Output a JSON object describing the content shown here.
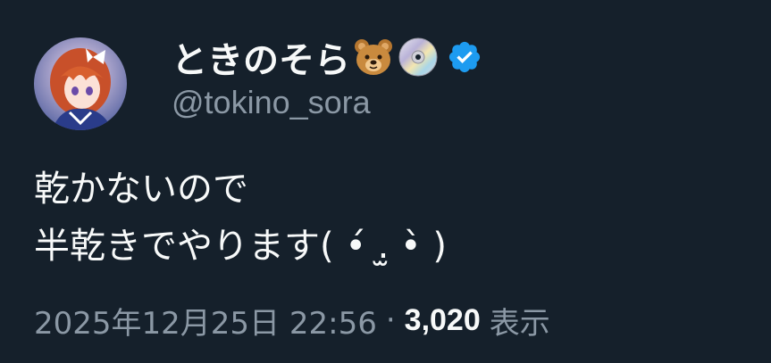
{
  "author": {
    "display_name": "ときのそら",
    "name_emojis": [
      "bear-face-emoji",
      "dvd-emoji"
    ],
    "verified_icon": "verified-badge-icon",
    "handle": "@tokino_sora",
    "avatar": "avatar"
  },
  "tweet": {
    "line1": "乾かないので",
    "line2": "半乾きでやります( •́ .̫ •̀ )"
  },
  "meta": {
    "timestamp": "2025年12月25日 22:56",
    "separator": "·",
    "views_count": "3,020",
    "views_label": "表示"
  },
  "colors": {
    "background": "#15202b",
    "primary_text": "#f7f9f9",
    "secondary_text": "#8b98a5",
    "verified": "#1d9bf0"
  }
}
